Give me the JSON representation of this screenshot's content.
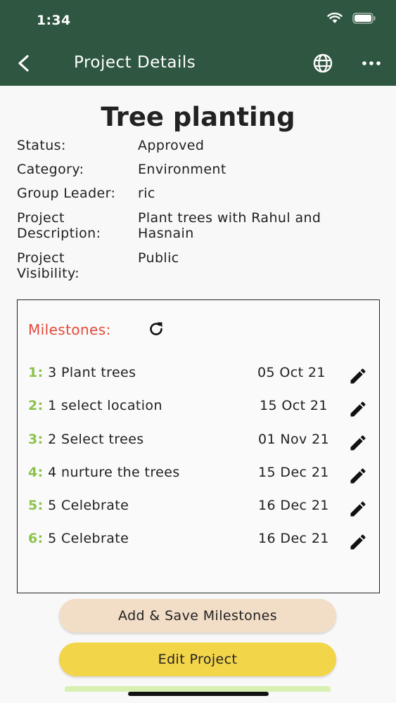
{
  "status_bar": {
    "time": "1:34"
  },
  "nav": {
    "title": "Project Details"
  },
  "project": {
    "title": "Tree planting",
    "fields": [
      {
        "label": "Status:",
        "value": "Approved"
      },
      {
        "label": "Category:",
        "value": "Environment"
      },
      {
        "label": "Group Leader:",
        "value": "ric"
      },
      {
        "label_line1": "Project",
        "label_line2": "Description:",
        "value_line1": "Plant trees with Rahul and",
        "value_line2": "Hasnain"
      },
      {
        "label_line1": "Project",
        "label_line2": "Visibility:",
        "value_line1": "Public"
      }
    ]
  },
  "milestones": {
    "title": "Milestones:",
    "items": [
      {
        "num": "1:",
        "name": "3 Plant trees",
        "date": "05 Oct 21"
      },
      {
        "num": "2:",
        "name": "1 select location",
        "date": "15 Oct 21"
      },
      {
        "num": "3:",
        "name": "2 Select trees",
        "date": "01 Nov 21"
      },
      {
        "num": "4:",
        "name": "4 nurture the trees",
        "date": "15 Dec 21"
      },
      {
        "num": "5:",
        "name": "5 Celebrate",
        "date": "16 Dec 21"
      },
      {
        "num": "6:",
        "name": "5 Celebrate",
        "date": "16 Dec 21"
      }
    ]
  },
  "buttons": {
    "add_save": "Add & Save Milestones",
    "edit": "Edit Project"
  },
  "colors": {
    "header": "#2e5640",
    "milestone_title": "#e34a3a",
    "milestone_number": "#8bc34a",
    "add_button": "#f2ddc7",
    "edit_button": "#f3d54a"
  },
  "icons": [
    "back-arrow-icon",
    "globe-icon",
    "more-icon",
    "refresh-icon",
    "pencil-icon",
    "wifi-icon",
    "signal-icon",
    "battery-icon"
  ]
}
